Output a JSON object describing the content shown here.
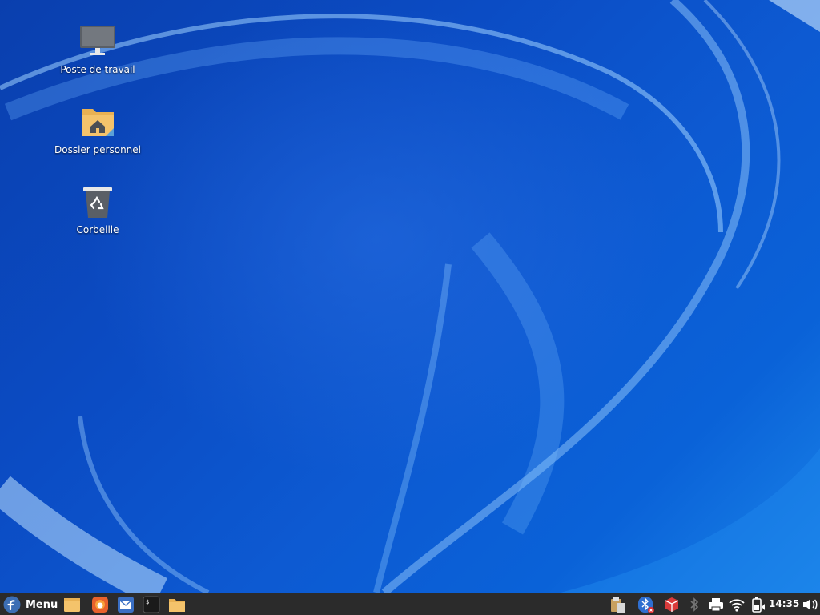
{
  "desktop": {
    "icons": [
      {
        "label": "Poste de travail",
        "icon": "computer-icon"
      },
      {
        "label": "Dossier personnel",
        "icon": "home-folder-icon"
      },
      {
        "label": "Corbeille",
        "icon": "trash-icon"
      }
    ]
  },
  "panel": {
    "menu_label": "Menu",
    "launchers": [
      "files-icon",
      "firefox-icon",
      "mail-icon",
      "terminal-icon",
      "folder-icon"
    ],
    "tray": [
      "clipboard-icon",
      "bluetooth-disabled-icon",
      "package-updates-icon",
      "bluetooth-icon",
      "printer-icon",
      "wifi-icon",
      "battery-icon",
      "volume-icon"
    ],
    "clock": "14:35"
  },
  "colors": {
    "wallpaper_base": "#0b4cc4",
    "panel_background": "#2b2b2b",
    "fedora_blue": "#3c6eb4",
    "firefox_orange": "#e8622c",
    "folder_yellow": "#f4c36b",
    "package_red": "#d93b3b"
  }
}
